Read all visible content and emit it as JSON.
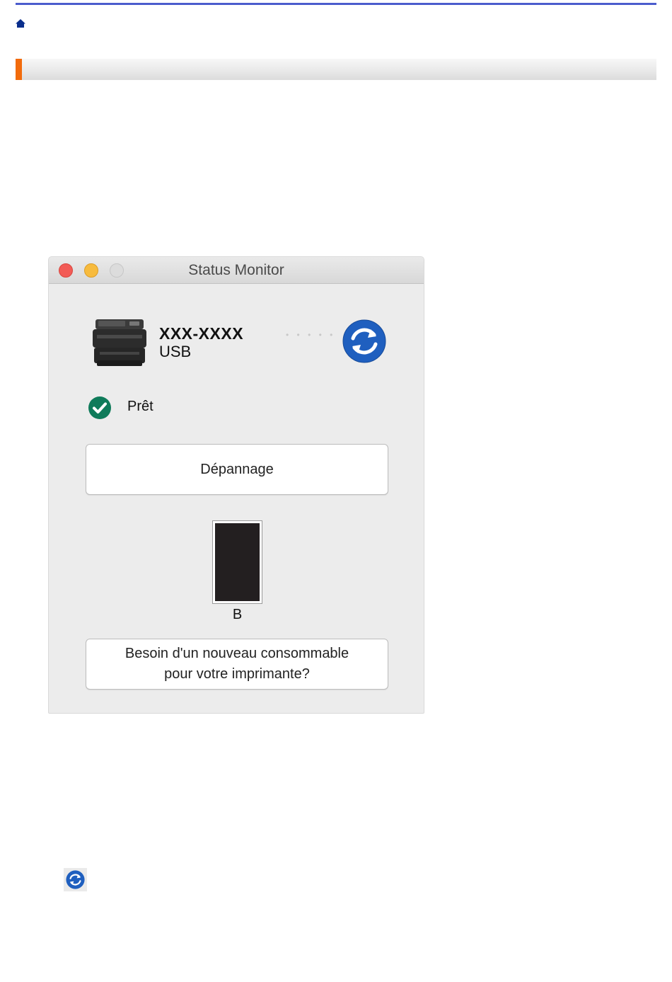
{
  "page": {
    "home_icon": "home-icon",
    "accent_color": "#f26b0c",
    "rule_color": "#4b5ccd"
  },
  "window": {
    "title": "Status Monitor",
    "printer": {
      "icon": "printer-icon",
      "model": "XXX-XXXX",
      "connection": "USB",
      "dots": "• • • • •"
    },
    "refresh_icon": "refresh-icon",
    "status": {
      "icon": "checkmark-circle-icon",
      "color": "#0f7b5a",
      "text": "Prêt"
    },
    "troubleshoot_label": "Dépannage",
    "toner": {
      "label": "B",
      "level": 1.0,
      "color": "#231f20"
    },
    "supplies_line1": "Besoin d'un nouveau consommable",
    "supplies_line2": "pour votre imprimante?"
  },
  "footer": {
    "refresh_icon": "refresh-icon"
  }
}
